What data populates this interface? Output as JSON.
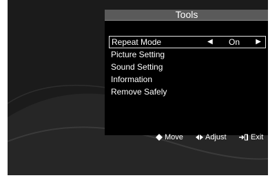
{
  "menu": {
    "title": "Tools",
    "items": [
      {
        "label": "Repeat Mode",
        "value": "On",
        "selected": true
      },
      {
        "label": "Picture Setting"
      },
      {
        "label": "Sound Setting"
      },
      {
        "label": "Information"
      },
      {
        "label": "Remove Safely"
      }
    ]
  },
  "footer": {
    "move": {
      "label": "Move",
      "icon": "up-down-icon"
    },
    "adjust": {
      "label": "Adjust",
      "icon": "left-right-icon"
    },
    "exit": {
      "label": "Exit",
      "icon": "exit-door-icon"
    }
  },
  "colors": {
    "panel_bg": "#000000",
    "title_bar": "#5a5a5a",
    "screen_bg": "#1b1b1b",
    "text": "#ffffff"
  }
}
